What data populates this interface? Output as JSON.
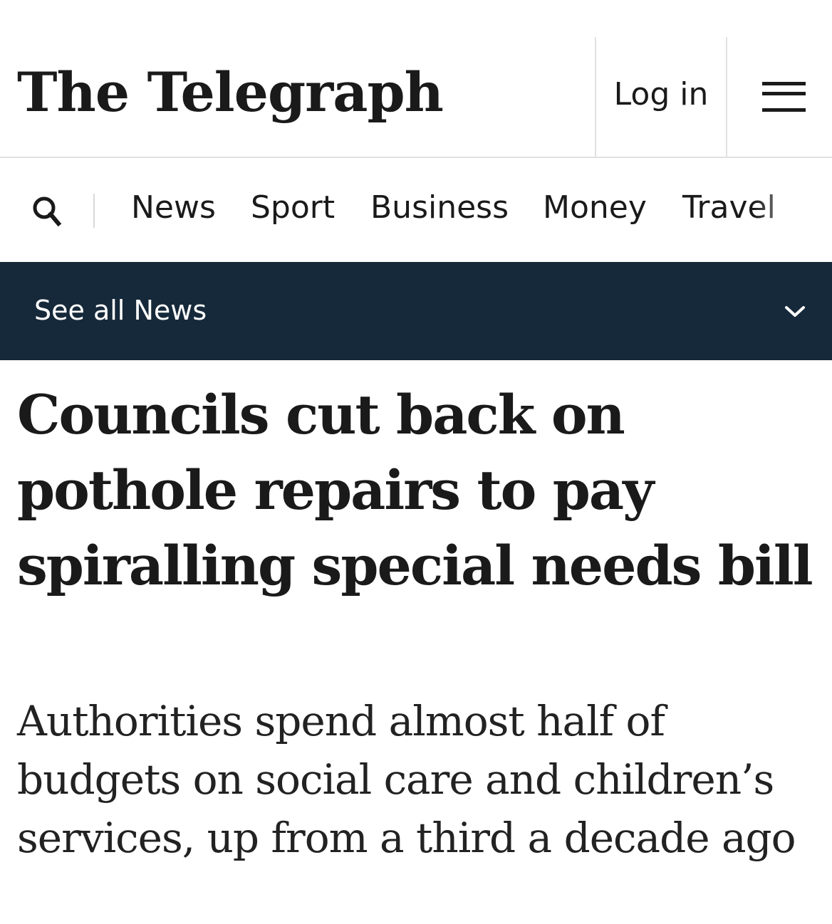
{
  "header": {
    "logo_text": "The Telegraph",
    "login_label": "Log in",
    "menu_icon": "hamburger-icon"
  },
  "nav": {
    "search_icon": "search-icon",
    "items": [
      {
        "label": "News"
      },
      {
        "label": "Sport"
      },
      {
        "label": "Business"
      },
      {
        "label": "Money"
      },
      {
        "label": "Travel"
      }
    ]
  },
  "section_bar": {
    "label": "See all News",
    "icon": "chevron-down-icon",
    "background": "#16293a"
  },
  "article": {
    "headline": "Councils cut back on pothole repairs to pay spiralling special needs bill",
    "standfirst": "Authorities spend almost half of budgets on social care and children’s services, up from a third a decade ago"
  }
}
